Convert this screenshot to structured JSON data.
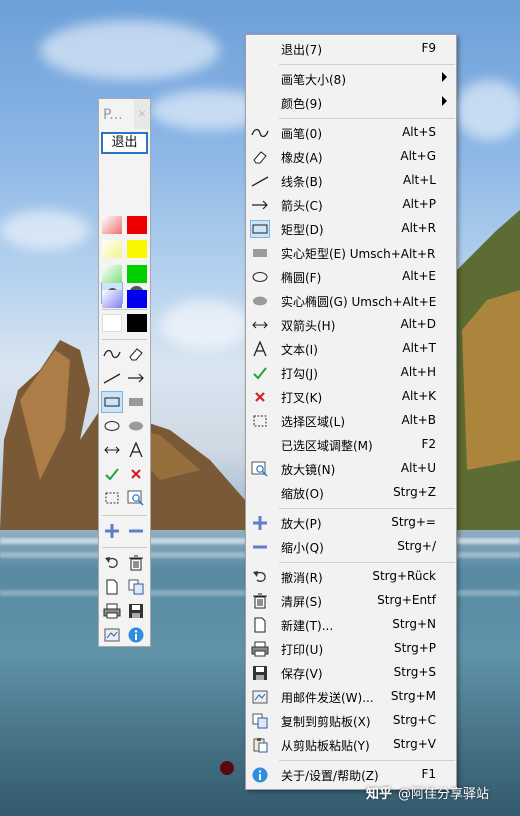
{
  "toolbar": {
    "title": "P...",
    "close": "×",
    "exit_label": "退出"
  },
  "colors": {
    "row1": [
      "#f07070",
      "#ee0000"
    ],
    "row2": [
      "#f5f38a",
      "#f9f700"
    ],
    "row3": [
      "#80e080",
      "#00d000"
    ],
    "row4": [
      "#8080f0",
      "#0000ee"
    ],
    "row5": [
      "#ffffff",
      "#000000"
    ],
    "accent": "#2b73c9"
  },
  "menu": {
    "items": [
      {
        "label": "退出(7)",
        "shortcut": "F9"
      },
      {
        "label": "画笔大小(8)",
        "shortcut": ""
      },
      {
        "label": "颜色(9)",
        "shortcut": ""
      },
      {
        "label": "画笔(0)",
        "shortcut": "Alt+S",
        "icon": "pen-icon"
      },
      {
        "label": "橡皮(A)",
        "shortcut": "Alt+G",
        "icon": "eraser-icon"
      },
      {
        "label": "线条(B)",
        "shortcut": "Alt+L",
        "icon": "line-icon"
      },
      {
        "label": "箭头(C)",
        "shortcut": "Alt+P",
        "icon": "arrow-icon"
      },
      {
        "label": "矩型(D)",
        "shortcut": "Alt+R",
        "icon": "rectangle-icon"
      },
      {
        "label": "实心矩型(E) Umsch+Alt+R",
        "shortcut": "",
        "icon": "filled-rectangle-icon"
      },
      {
        "label": "椭圆(F)",
        "shortcut": "Alt+E",
        "icon": "ellipse-icon"
      },
      {
        "label": "实心椭圆(G) Umsch+Alt+E",
        "shortcut": "",
        "icon": "filled-ellipse-icon"
      },
      {
        "label": "双箭头(H)",
        "shortcut": "Alt+D",
        "icon": "double-arrow-icon"
      },
      {
        "label": "文本(I)",
        "shortcut": "Alt+T",
        "icon": "text-icon"
      },
      {
        "label": "打勾(J)",
        "shortcut": "Alt+H",
        "icon": "checkmark-icon"
      },
      {
        "label": "打叉(K)",
        "shortcut": "Alt+K",
        "icon": "cross-icon"
      },
      {
        "label": "选择区域(L)",
        "shortcut": "Alt+B",
        "icon": "select-area-icon"
      },
      {
        "label": "已选区域调整(M)",
        "shortcut": "F2",
        "icon": ""
      },
      {
        "label": "放大镜(N)",
        "shortcut": "Alt+U",
        "icon": "magnifier-icon"
      },
      {
        "label": "缩放(O)",
        "shortcut": "Strg+Z",
        "icon": ""
      },
      {
        "label": "放大(P)",
        "shortcut": "Strg+=",
        "icon": "plus-icon"
      },
      {
        "label": "缩小(Q)",
        "shortcut": "Strg+/",
        "icon": "minus-icon"
      },
      {
        "label": "撤消(R)",
        "shortcut": "Strg+Rück",
        "icon": "undo-icon"
      },
      {
        "label": "清屏(S)",
        "shortcut": "Strg+Entf",
        "icon": "trash-icon"
      },
      {
        "label": "新建(T)...",
        "shortcut": "Strg+N",
        "icon": "new-document-icon"
      },
      {
        "label": "打印(U)",
        "shortcut": "Strg+P",
        "icon": "printer-icon"
      },
      {
        "label": "保存(V)",
        "shortcut": "Strg+S",
        "icon": "save-icon"
      },
      {
        "label": "用邮件发送(W)...",
        "shortcut": "Strg+M",
        "icon": "email-icon"
      },
      {
        "label": "复制到剪贴板(X)",
        "shortcut": "Strg+C",
        "icon": "copy-icon"
      },
      {
        "label": "从剪贴板粘贴(Y)",
        "shortcut": "Strg+V",
        "icon": "paste-icon"
      },
      {
        "label": "关于/设置/帮助(Z)",
        "shortcut": "F1",
        "icon": "info-icon"
      }
    ]
  },
  "watermark": {
    "brand": "知乎",
    "text": "@阿佳分享驿站"
  }
}
